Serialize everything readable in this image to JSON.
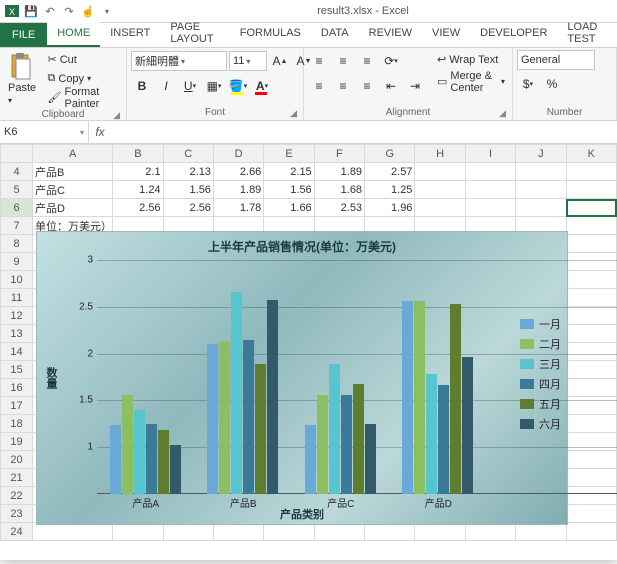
{
  "window": {
    "title": "result3.xlsx - Excel"
  },
  "qat": {
    "save": "Save",
    "undo": "Undo",
    "redo": "Redo",
    "touch": "Touch/Mouse"
  },
  "tabs": {
    "file": "FILE",
    "list": [
      "HOME",
      "INSERT",
      "PAGE LAYOUT",
      "FORMULAS",
      "DATA",
      "REVIEW",
      "VIEW",
      "DEVELOPER",
      "LOAD TEST"
    ],
    "active": "HOME"
  },
  "ribbon": {
    "clipboard": {
      "paste": "Paste",
      "cut": "Cut",
      "copy": "Copy",
      "fmt": "Format Painter",
      "label": "Clipboard"
    },
    "font": {
      "name": "新細明體",
      "size": "11",
      "label": "Font"
    },
    "alignment": {
      "wrap": "Wrap Text",
      "merge": "Merge & Center",
      "label": "Alignment"
    },
    "number": {
      "style": "General",
      "label": "Number"
    }
  },
  "nameBox": "K6",
  "formula": "",
  "sheet": {
    "cols": [
      "A",
      "B",
      "C",
      "D",
      "E",
      "F",
      "G",
      "H",
      "I",
      "J",
      "K"
    ],
    "rowStart": 4,
    "rows": [
      {
        "n": 4,
        "cells": [
          "产品B",
          "2.1",
          "2.13",
          "2.66",
          "2.15",
          "1.89",
          "2.57",
          "",
          "",
          "",
          ""
        ]
      },
      {
        "n": 5,
        "cells": [
          "产品C",
          "1.24",
          "1.56",
          "1.89",
          "1.56",
          "1.68",
          "1.25",
          "",
          "",
          "",
          ""
        ]
      },
      {
        "n": 6,
        "cells": [
          "产品D",
          "2.56",
          "2.56",
          "1.78",
          "1.66",
          "2.53",
          "1.96",
          "",
          "",
          "",
          ""
        ]
      },
      {
        "n": 7,
        "cells": [
          "单位：万美元）",
          "",
          "",
          "",
          "",
          "",
          "",
          "",
          "",
          "",
          ""
        ]
      }
    ],
    "blankRows": [
      8,
      9,
      10,
      11,
      12,
      13,
      14,
      15,
      16,
      17,
      18,
      19,
      20,
      21,
      22,
      23,
      24
    ]
  },
  "chart_data": {
    "type": "bar",
    "title": "上半年产品销售情况(单位：万美元)",
    "xlabel": "产品类别",
    "ylabel": "数量",
    "ylim": [
      0.5,
      3
    ],
    "yticks": [
      1,
      1.5,
      2,
      2.5,
      3
    ],
    "categories": [
      "产品A",
      "产品B",
      "产品C",
      "产品D"
    ],
    "series": [
      {
        "name": "一月",
        "color": "#6aa8d8",
        "values": [
          1.24,
          2.1,
          1.24,
          2.56
        ]
      },
      {
        "name": "二月",
        "color": "#8bbf62",
        "values": [
          1.56,
          2.13,
          1.56,
          2.56
        ]
      },
      {
        "name": "三月",
        "color": "#57c5d0",
        "values": [
          1.4,
          2.66,
          1.89,
          1.78
        ]
      },
      {
        "name": "四月",
        "color": "#3a7a97",
        "values": [
          1.25,
          2.15,
          1.56,
          1.66
        ]
      },
      {
        "name": "五月",
        "color": "#5f7d2f",
        "values": [
          1.18,
          1.89,
          1.68,
          2.53
        ]
      },
      {
        "name": "六月",
        "color": "#335a6b",
        "values": [
          1.02,
          2.57,
          1.25,
          1.96
        ]
      }
    ],
    "legend_position": "right"
  }
}
